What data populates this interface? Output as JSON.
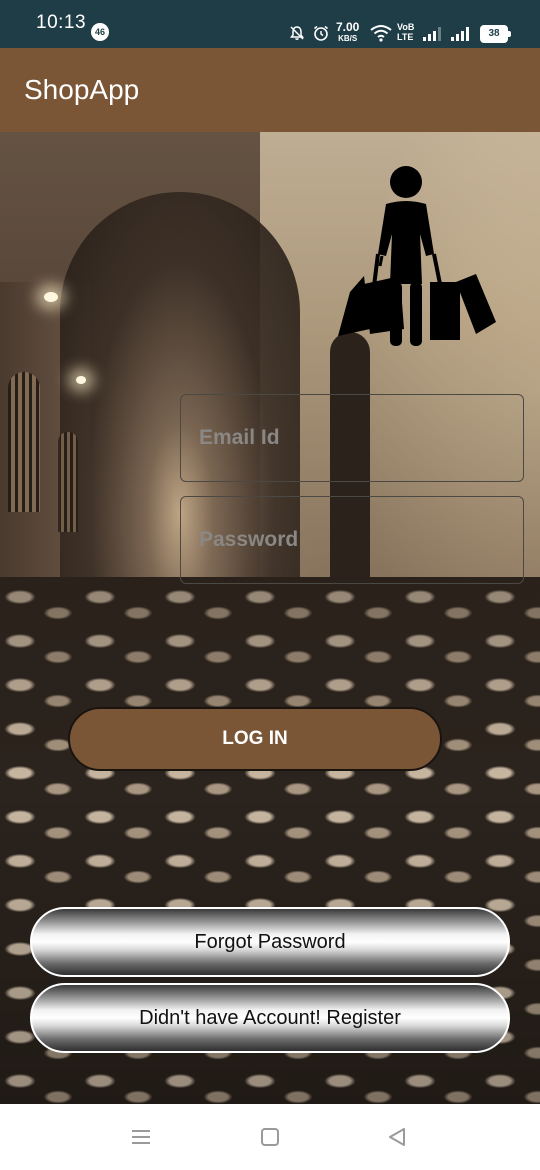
{
  "status_bar": {
    "time": "10:13",
    "notification_badge": "46",
    "net_speed_value": "7.00",
    "net_speed_unit": "KB/S",
    "network_label_top": "VoB",
    "network_label_bottom": "LTE",
    "battery_level": "38",
    "icons": [
      "mute-icon",
      "alarm-icon",
      "wifi-icon",
      "signal-icon",
      "signal-icon-2"
    ]
  },
  "app_bar": {
    "title": "ShopApp"
  },
  "login_form": {
    "email_placeholder": "Email Id",
    "password_placeholder": "Password",
    "login_label": "LOG IN",
    "forgot_label": "Forgot Password",
    "register_label": "Didn't have Account! Register"
  },
  "nav_bar": {
    "icons": [
      "recents-icon",
      "home-icon",
      "back-icon"
    ]
  },
  "colors": {
    "status_bar": "#1f3d46",
    "app_bar": "#7a5536",
    "login_button": "#7a5536"
  }
}
